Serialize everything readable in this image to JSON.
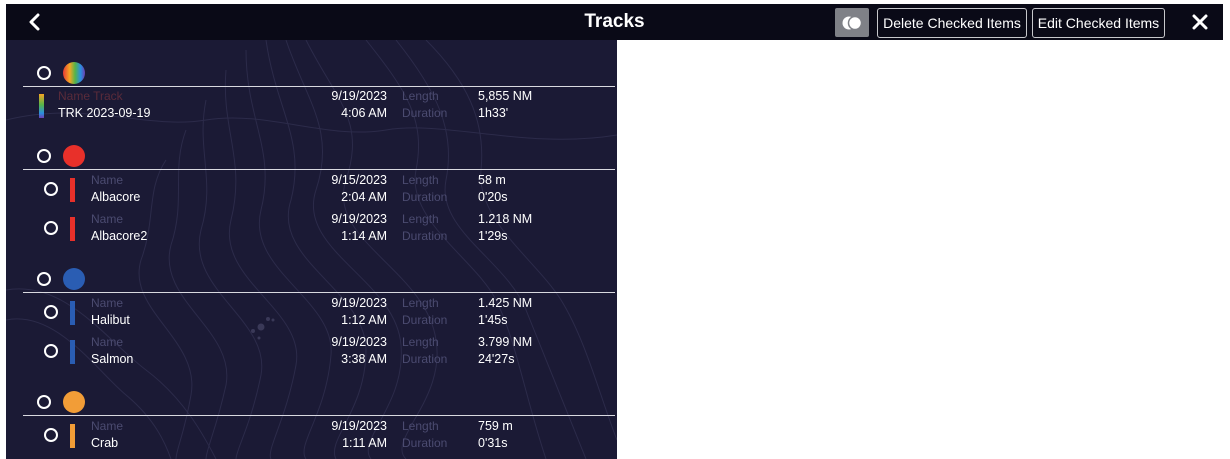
{
  "header": {
    "title": "Tracks",
    "delete_label": "Delete Checked Items",
    "edit_label": "Edit Checked Items"
  },
  "labels": {
    "name": "Name",
    "length": "Length",
    "duration": "Duration"
  },
  "colors": {
    "topbar": "#0a0a17",
    "panel": "#1b1a35",
    "red": "#e8302a",
    "blue": "#2a5db3",
    "orange": "#f29d37"
  },
  "groups": [
    {
      "color": "multicolor",
      "tracks": [
        {
          "name_label": "Name Track",
          "name": "TRK 2023-09-19",
          "date": "9/19/2023",
          "time": "4:06 AM",
          "length": "5,855 NM",
          "duration": "1h33'"
        }
      ]
    },
    {
      "color": "red",
      "tracks": [
        {
          "name": "Albacore",
          "date": "9/15/2023",
          "time": "2:04 AM",
          "length": "58 m",
          "duration": "0'20s"
        },
        {
          "name": "Albacore2",
          "date": "9/19/2023",
          "time": "1:14 AM",
          "length": "1.218 NM",
          "duration": "1'29s"
        }
      ]
    },
    {
      "color": "blue",
      "tracks": [
        {
          "name": "Halibut",
          "date": "9/19/2023",
          "time": "1:12 AM",
          "length": "1.425 NM",
          "duration": "1'45s"
        },
        {
          "name": "Salmon",
          "date": "9/19/2023",
          "time": "3:38 AM",
          "length": "3.799 NM",
          "duration": "24'27s"
        }
      ]
    },
    {
      "color": "orange",
      "tracks": [
        {
          "name": "Crab",
          "date": "9/19/2023",
          "time": "1:11 AM",
          "length": "759 m",
          "duration": "0'31s"
        }
      ]
    }
  ]
}
